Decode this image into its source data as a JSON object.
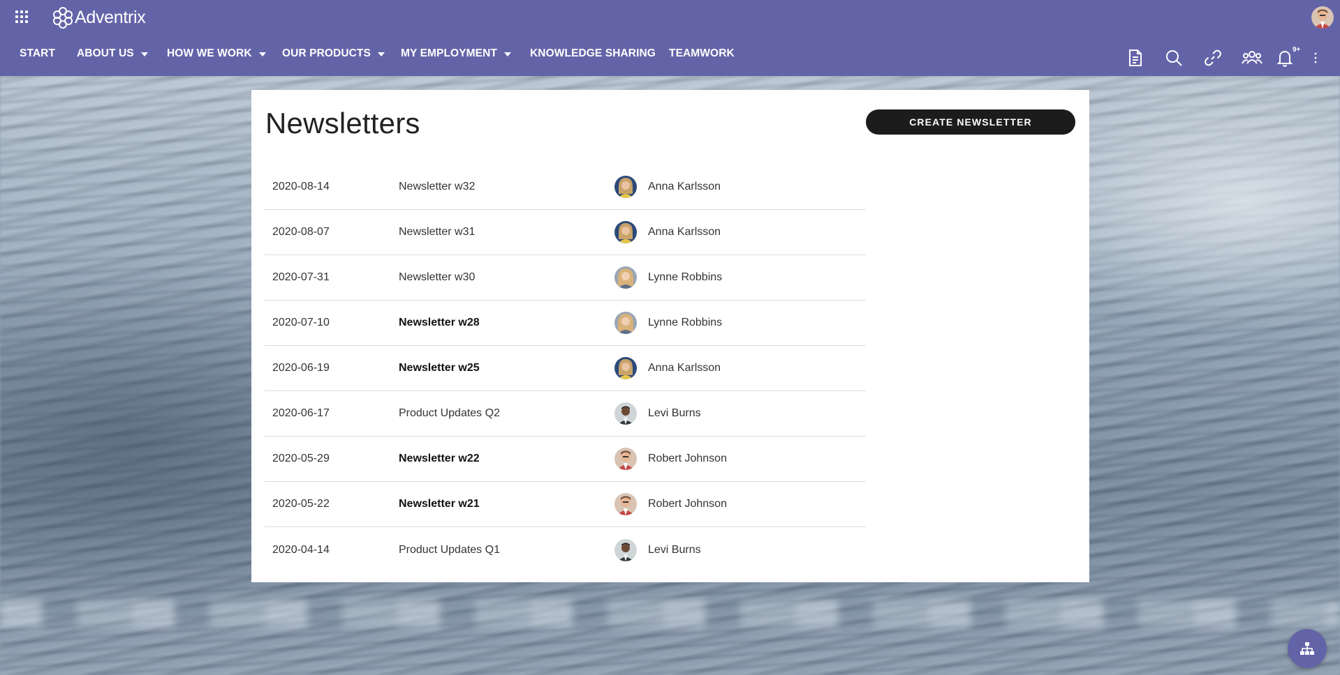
{
  "brand": {
    "name": "Adventrix"
  },
  "colors": {
    "header": "#6364a8",
    "button": "#1c1c1c",
    "fab": "#6364a8"
  },
  "nav": [
    {
      "label": "START",
      "dropdown": false
    },
    {
      "label": "ABOUT US",
      "dropdown": true
    },
    {
      "label": "HOW WE WORK",
      "dropdown": true
    },
    {
      "label": "OUR PRODUCTS",
      "dropdown": true
    },
    {
      "label": "MY EMPLOYMENT",
      "dropdown": true
    },
    {
      "label": "KNOWLEDGE SHARING",
      "dropdown": false
    },
    {
      "label": "TEAMWORK",
      "dropdown": false
    }
  ],
  "toolbar": {
    "icons": [
      "document-icon",
      "search-icon",
      "link-icon",
      "people-icon",
      "bell-icon",
      "more-vertical-icon"
    ],
    "notification_badge": "9+"
  },
  "main": {
    "title": "Newsletters",
    "create_button": "CREATE NEWSLETTER",
    "newsletters": [
      {
        "date": "2020-08-14",
        "title": "Newsletter w32",
        "author": "Anna Karlsson",
        "unread": false
      },
      {
        "date": "2020-08-07",
        "title": "Newsletter w31",
        "author": "Anna Karlsson",
        "unread": false
      },
      {
        "date": "2020-07-31",
        "title": "Newsletter w30",
        "author": "Lynne Robbins",
        "unread": false
      },
      {
        "date": "2020-07-10",
        "title": "Newsletter w28",
        "author": "Lynne Robbins",
        "unread": true
      },
      {
        "date": "2020-06-19",
        "title": "Newsletter w25",
        "author": "Anna Karlsson",
        "unread": true
      },
      {
        "date": "2020-06-17",
        "title": "Product Updates Q2",
        "author": "Levi Burns",
        "unread": false
      },
      {
        "date": "2020-05-29",
        "title": "Newsletter w22",
        "author": "Robert Johnson",
        "unread": true
      },
      {
        "date": "2020-05-22",
        "title": "Newsletter w21",
        "author": "Robert Johnson",
        "unread": true
      },
      {
        "date": "2020-04-14",
        "title": "Product Updates Q1",
        "author": "Levi Burns",
        "unread": false
      }
    ]
  },
  "fab": {
    "icon": "sitemap-icon"
  }
}
